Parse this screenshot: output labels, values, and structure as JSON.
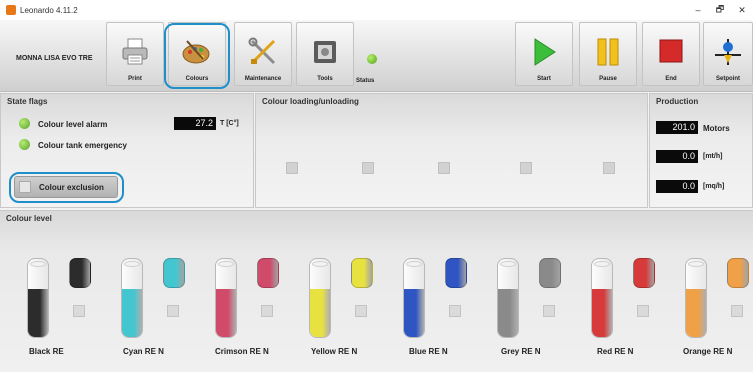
{
  "window": {
    "title": "Leonardo 4.11.2",
    "controls": [
      "–",
      "🗗",
      "✕"
    ]
  },
  "toolbar": {
    "machine_name": "MONNA LISA EVO TRE",
    "buttons": {
      "print": "Print",
      "colours": "Colours",
      "maintenance": "Maintenance",
      "tools": "Tools",
      "status": "Status",
      "start": "Start",
      "pause": "Pause",
      "end": "End",
      "setpoint": "Setpoint"
    },
    "status_color": "#5ab62a"
  },
  "state_flags": {
    "title": "State flags",
    "colour_level_alarm": "Colour level alarm",
    "colour_tank_emergency": "Colour tank emergency",
    "temperature_value": "27.2",
    "temperature_unit": "T [C°]",
    "colour_exclusion": "Colour exclusion"
  },
  "loading": {
    "title": "Colour loading/unloading"
  },
  "production": {
    "title": "Production",
    "motors_value": "201.0",
    "motors_label": "Motors",
    "speed_value": "0.0",
    "speed_unit": "[mt/h]",
    "area_value": "0.0",
    "area_unit": "[mq/h]"
  },
  "colour_level": {
    "title": "Colour level",
    "colours": [
      {
        "name": "Black RE",
        "color": "#2c2c2c",
        "level": 0.62
      },
      {
        "name": "Cyan RE N",
        "color": "#43c6d0",
        "level": 0.62
      },
      {
        "name": "Crimson RE N",
        "color": "#d04a6a",
        "level": 0.62
      },
      {
        "name": "Yellow RE N",
        "color": "#e8e241",
        "level": 0.62
      },
      {
        "name": "Blue RE N",
        "color": "#2f55c2",
        "level": 0.62
      },
      {
        "name": "Grey RE N",
        "color": "#8a8a8a",
        "level": 0.62
      },
      {
        "name": "Red RE N",
        "color": "#d63a3a",
        "level": 0.62
      },
      {
        "name": "Orange RE N",
        "color": "#f0a046",
        "level": 0.62
      }
    ]
  }
}
